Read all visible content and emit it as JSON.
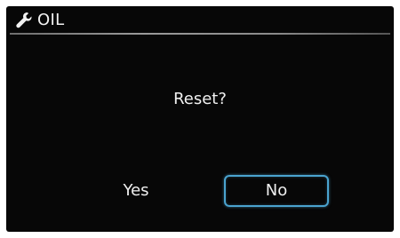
{
  "header": {
    "icon": "wrench-icon",
    "title": "OIL"
  },
  "dialog": {
    "question": "Reset?",
    "options": [
      {
        "label": "Yes",
        "selected": false
      },
      {
        "label": "No",
        "selected": true
      }
    ]
  },
  "colors": {
    "background": "#070707",
    "text": "#f0f0f0",
    "selection_border": "#4aa3cf",
    "divider": "#9a9a9a"
  }
}
